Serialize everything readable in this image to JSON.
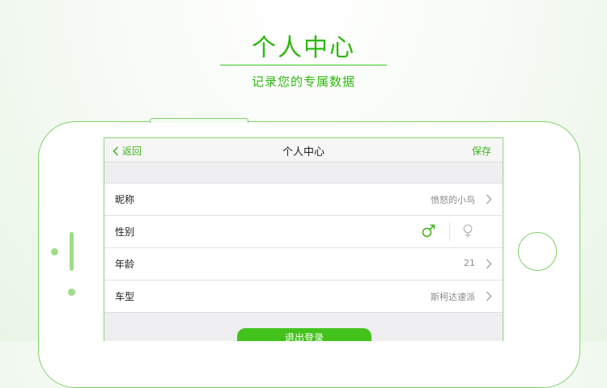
{
  "promo": {
    "title": "个人中心",
    "subtitle": "记录您的专属数据"
  },
  "navbar": {
    "back_label": "返回",
    "title": "个人中心",
    "save_label": "保存"
  },
  "profile": {
    "rows": [
      {
        "label": "昵称",
        "value": "愤怒的小鸟"
      },
      {
        "label": "性别",
        "value": ""
      },
      {
        "label": "年龄",
        "value": "21"
      },
      {
        "label": "车型",
        "value": "斯柯达速派"
      }
    ],
    "selected_gender": "male"
  },
  "logout_label": "退出登录",
  "colors": {
    "accent": "#44c21c",
    "phone_outline": "#7ed264"
  },
  "icons": [
    "chevron-left-icon",
    "chevron-right-icon",
    "male-icon",
    "female-icon"
  ]
}
